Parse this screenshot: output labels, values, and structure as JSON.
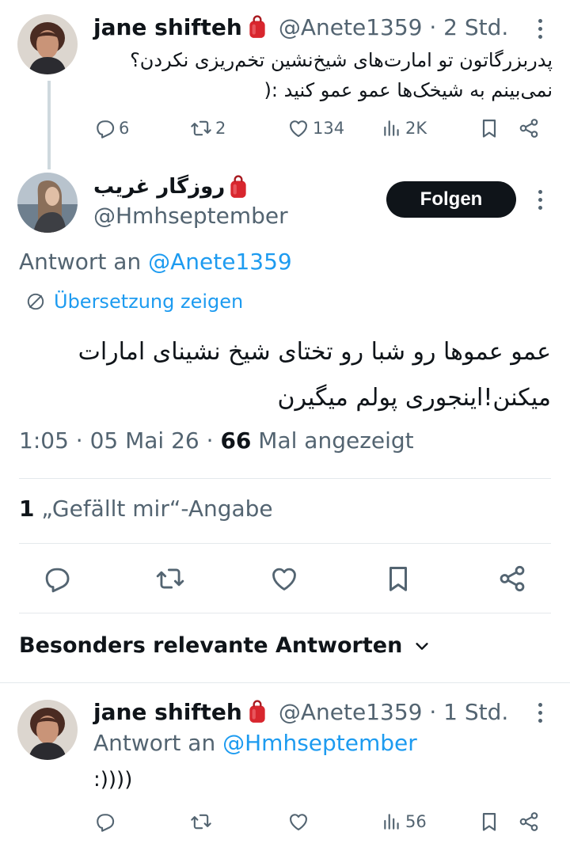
{
  "tweet1": {
    "name": "jane shifteh",
    "handle_time": "@Anete1359 · 2 Std.",
    "text_line1": "پدربزرگاتون تو امارت‌های شیخ‌نشین تخم‌ریزی نکردن؟",
    "text_line2": "نمی‌بینم به شیخک‌ها عمو عمو کنید :(",
    "replies": "6",
    "reposts": "2",
    "likes": "134",
    "views": "2K"
  },
  "tweet2": {
    "name": "روزگار غریب",
    "handle": "@Hmhseptember",
    "follow_label": "Folgen",
    "reply_to_prefix": "Antwort an",
    "reply_to_handle": "@Anete1359",
    "translate_label": "Übersetzung zeigen",
    "text_line1": "عمو عموها رو شبا رو تختای شیخ نشینای امارات",
    "text_line2": "میکنن!اینجوری پولم میگیرن",
    "time": "1:05 · 05 Mai 26 · ",
    "views_count": "66",
    "views_label": " Mal angezeigt",
    "likes_count": "1",
    "likes_label": " „Gefällt mir“-Angabe"
  },
  "sort": {
    "label": "Besonders relevante Antworten"
  },
  "tweet3": {
    "name": "jane shifteh",
    "handle_time": "@Anete1359 · 1 Std.",
    "reply_to_prefix": "Antwort an",
    "reply_to_handle": "@Hmhseptember",
    "text": ":))))",
    "views": "56"
  },
  "colors": {
    "accent": "#1d9bf0",
    "muted": "#536471",
    "text": "#0f1419",
    "badge": "#d8262e"
  },
  "icons": [
    "reply-icon",
    "repost-icon",
    "like-icon",
    "views-icon",
    "bookmark-icon",
    "share-icon",
    "more-icon",
    "red-bag-emoji",
    "translate-icon",
    "chevron-down-icon"
  ]
}
